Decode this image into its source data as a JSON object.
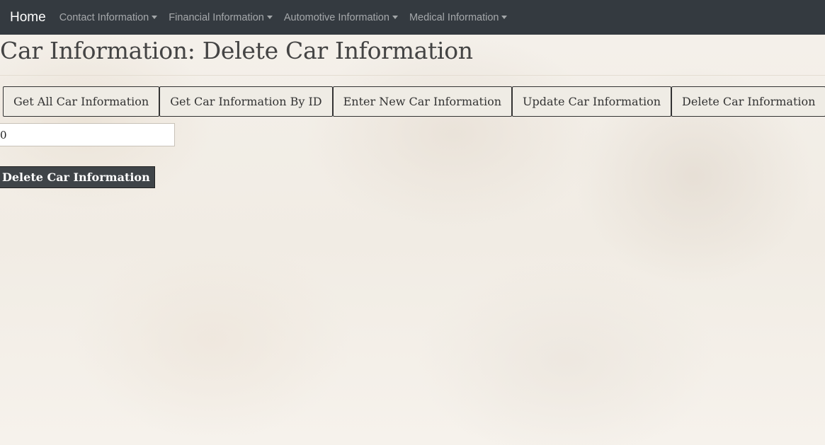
{
  "navbar": {
    "brand": "Home",
    "menus": [
      {
        "label": "Contact Information"
      },
      {
        "label": "Financial Information"
      },
      {
        "label": "Automotive Information"
      },
      {
        "label": "Medical Information"
      }
    ]
  },
  "page": {
    "title": "Car Information: Delete Car Information"
  },
  "tabs": [
    {
      "label": "Get All Car Information"
    },
    {
      "label": "Get Car Information By ID"
    },
    {
      "label": "Enter New Car Information"
    },
    {
      "label": "Update Car Information"
    },
    {
      "label": "Delete Car Information"
    }
  ],
  "form": {
    "id_value": "0",
    "submit_label": "Delete Car Information"
  },
  "colors": {
    "navbar_bg": "#343a40",
    "submit_bg": "#3f4448"
  }
}
